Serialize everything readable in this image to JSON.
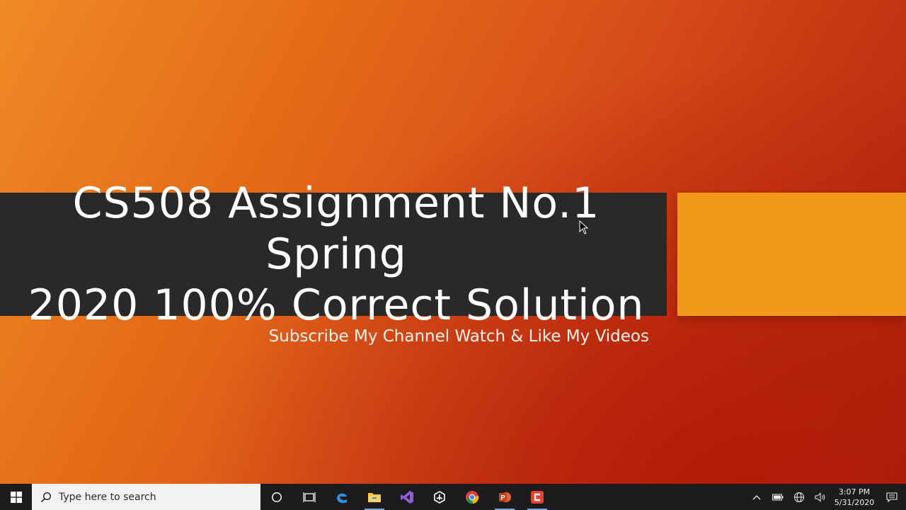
{
  "slide": {
    "title_line1": "CS508 Assignment No.1 Spring",
    "title_line2": "2020 100% Correct Solution",
    "subtitle": "Subscribe My Channel Watch & Like My Videos",
    "colors": {
      "background_start": "#ef8a26",
      "background_end": "#a8210c",
      "title_band": "#2a2927",
      "accent_box": "#f09a1a"
    }
  },
  "taskbar": {
    "search_placeholder": "Type here to search",
    "pinned_apps": [
      {
        "name": "cortana-icon"
      },
      {
        "name": "task-view-icon"
      },
      {
        "name": "edge-icon"
      },
      {
        "name": "file-explorer-icon"
      },
      {
        "name": "visual-studio-icon"
      },
      {
        "name": "unity-icon"
      },
      {
        "name": "chrome-icon"
      },
      {
        "name": "powerpoint-icon"
      },
      {
        "name": "camtasia-icon"
      }
    ],
    "clock": {
      "time": "3:07 PM",
      "date": "5/31/2020"
    }
  }
}
